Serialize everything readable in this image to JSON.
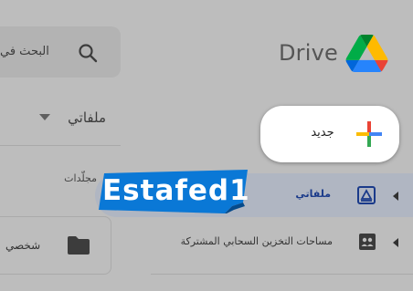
{
  "header": {
    "app_name": "Drive",
    "search_placeholder": "البحث في"
  },
  "left": {
    "my_files_title": "ملفاتي",
    "folders_label": "مجلّدات",
    "folder_name": "شخصي"
  },
  "sidebar": {
    "new_button_label": "جديد",
    "items": [
      {
        "label": "ملفاتي",
        "icon": "my-drive-icon",
        "selected": true
      },
      {
        "label": "مساحات التخزين السحابي المشتركة",
        "icon": "shared-drives-icon",
        "selected": false
      }
    ]
  },
  "watermark": {
    "text": "Estafed1"
  },
  "colors": {
    "background": "#bdbdbd",
    "selected_row": "#b0b6c2",
    "selected_text": "#1a3a8a",
    "watermark_blue": "#0a78d6",
    "google_blue": "#4285f4",
    "google_red": "#ea4335",
    "google_yellow": "#fbbc04",
    "google_green": "#34a853"
  }
}
